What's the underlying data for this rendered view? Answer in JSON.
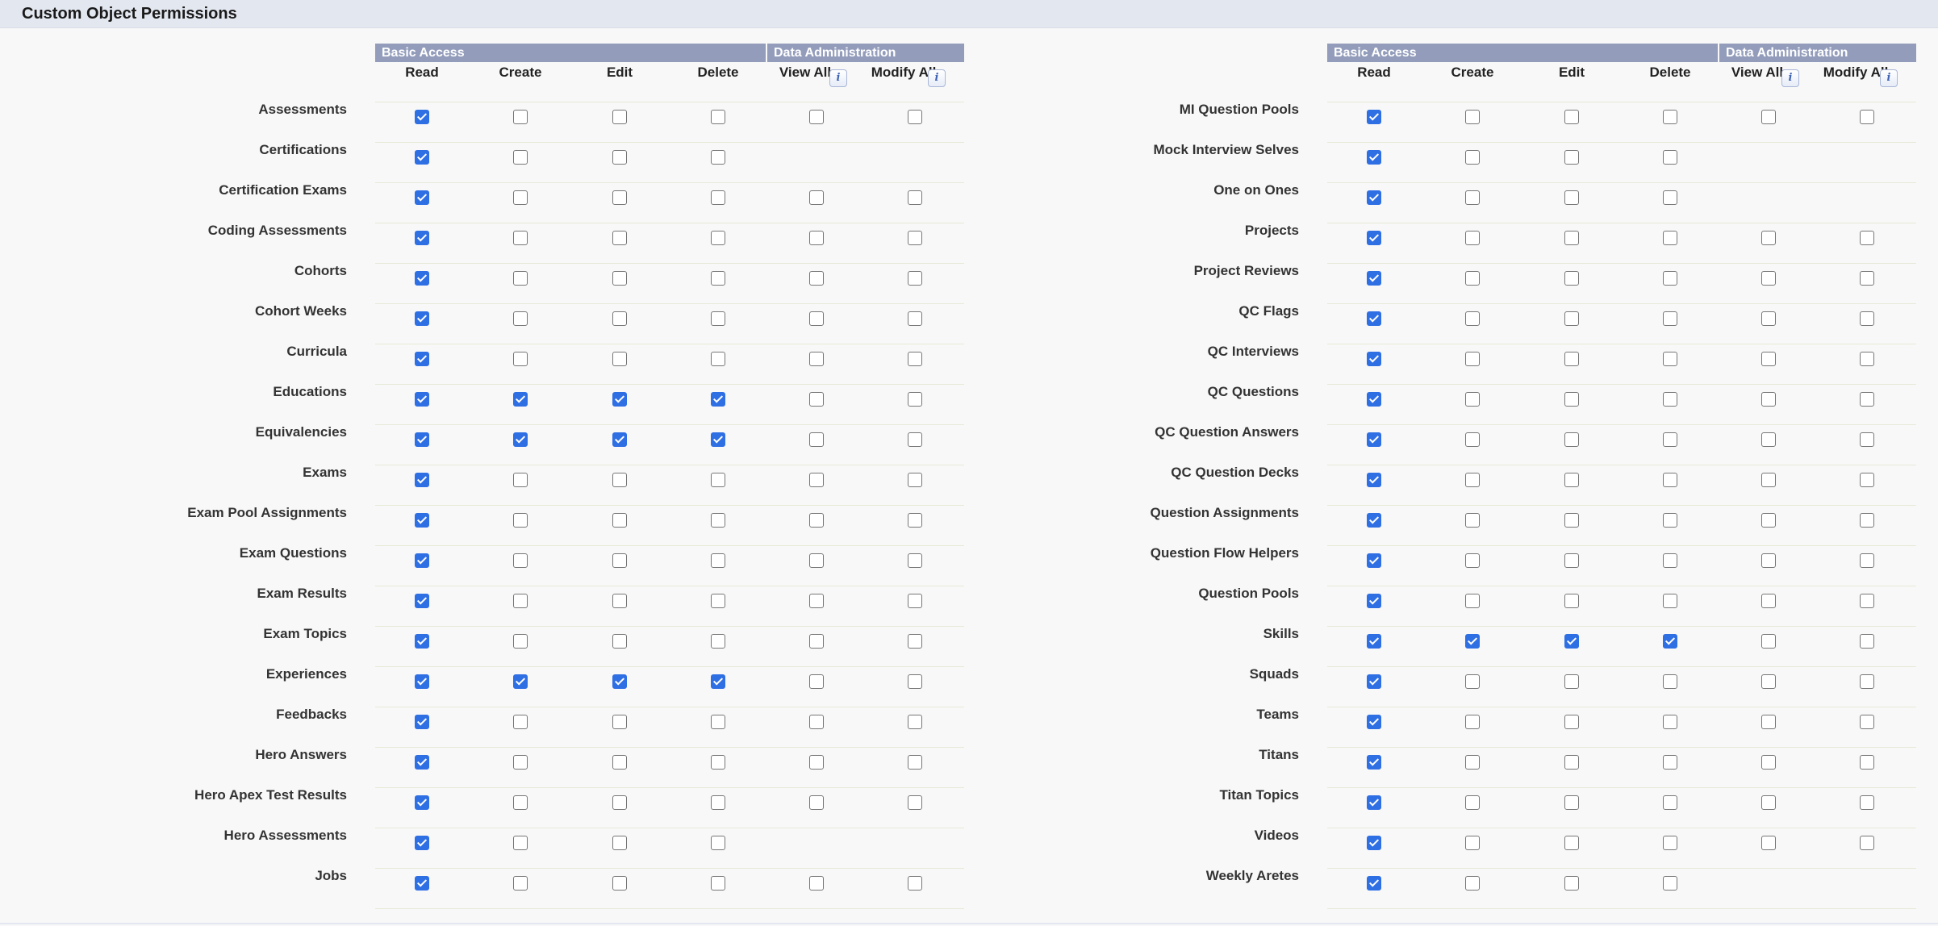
{
  "page": {
    "title": "Custom Object Permissions"
  },
  "groups": {
    "basic": "Basic Access",
    "admin": "Data Administration"
  },
  "columns": {
    "read": "Read",
    "create": "Create",
    "edit": "Edit",
    "delete": "Delete",
    "view_all": "View All",
    "modify_all": "Modify All"
  },
  "info_icon_glyph": "i",
  "colors": {
    "checked": "#2f6fe4",
    "group_header": "#939dbb",
    "title_bar": "#e3e7ef"
  },
  "tables": [
    {
      "rows": [
        {
          "label": "Assessments",
          "perms": [
            1,
            0,
            0,
            0,
            0,
            0
          ]
        },
        {
          "label": "Certifications",
          "perms": [
            1,
            0,
            0,
            0,
            null,
            null
          ]
        },
        {
          "label": "Certification Exams",
          "perms": [
            1,
            0,
            0,
            0,
            0,
            0
          ]
        },
        {
          "label": "Coding Assessments",
          "perms": [
            1,
            0,
            0,
            0,
            0,
            0
          ]
        },
        {
          "label": "Cohorts",
          "perms": [
            1,
            0,
            0,
            0,
            0,
            0
          ]
        },
        {
          "label": "Cohort Weeks",
          "perms": [
            1,
            0,
            0,
            0,
            0,
            0
          ]
        },
        {
          "label": "Curricula",
          "perms": [
            1,
            0,
            0,
            0,
            0,
            0
          ]
        },
        {
          "label": "Educations",
          "perms": [
            1,
            1,
            1,
            1,
            0,
            0
          ]
        },
        {
          "label": "Equivalencies",
          "perms": [
            1,
            1,
            1,
            1,
            0,
            0
          ]
        },
        {
          "label": "Exams",
          "perms": [
            1,
            0,
            0,
            0,
            0,
            0
          ]
        },
        {
          "label": "Exam Pool Assignments",
          "perms": [
            1,
            0,
            0,
            0,
            0,
            0
          ]
        },
        {
          "label": "Exam Questions",
          "perms": [
            1,
            0,
            0,
            0,
            0,
            0
          ]
        },
        {
          "label": "Exam Results",
          "perms": [
            1,
            0,
            0,
            0,
            0,
            0
          ]
        },
        {
          "label": "Exam Topics",
          "perms": [
            1,
            0,
            0,
            0,
            0,
            0
          ]
        },
        {
          "label": "Experiences",
          "perms": [
            1,
            1,
            1,
            1,
            0,
            0
          ]
        },
        {
          "label": "Feedbacks",
          "perms": [
            1,
            0,
            0,
            0,
            0,
            0
          ]
        },
        {
          "label": "Hero Answers",
          "perms": [
            1,
            0,
            0,
            0,
            0,
            0
          ]
        },
        {
          "label": "Hero Apex Test Results",
          "perms": [
            1,
            0,
            0,
            0,
            0,
            0
          ]
        },
        {
          "label": "Hero Assessments",
          "perms": [
            1,
            0,
            0,
            0,
            null,
            null
          ]
        },
        {
          "label": "Jobs",
          "perms": [
            1,
            0,
            0,
            0,
            0,
            0
          ]
        }
      ]
    },
    {
      "rows": [
        {
          "label": "MI Question Pools",
          "perms": [
            1,
            0,
            0,
            0,
            0,
            0
          ]
        },
        {
          "label": "Mock Interview Selves",
          "perms": [
            1,
            0,
            0,
            0,
            null,
            null
          ]
        },
        {
          "label": "One on Ones",
          "perms": [
            1,
            0,
            0,
            0,
            null,
            null
          ]
        },
        {
          "label": "Projects",
          "perms": [
            1,
            0,
            0,
            0,
            0,
            0
          ]
        },
        {
          "label": "Project Reviews",
          "perms": [
            1,
            0,
            0,
            0,
            0,
            0
          ]
        },
        {
          "label": "QC Flags",
          "perms": [
            1,
            0,
            0,
            0,
            0,
            0
          ]
        },
        {
          "label": "QC Interviews",
          "perms": [
            1,
            0,
            0,
            0,
            0,
            0
          ]
        },
        {
          "label": "QC Questions",
          "perms": [
            1,
            0,
            0,
            0,
            0,
            0
          ]
        },
        {
          "label": "QC Question Answers",
          "perms": [
            1,
            0,
            0,
            0,
            0,
            0
          ]
        },
        {
          "label": "QC Question Decks",
          "perms": [
            1,
            0,
            0,
            0,
            0,
            0
          ]
        },
        {
          "label": "Question Assignments",
          "perms": [
            1,
            0,
            0,
            0,
            0,
            0
          ]
        },
        {
          "label": "Question Flow Helpers",
          "perms": [
            1,
            0,
            0,
            0,
            0,
            0
          ]
        },
        {
          "label": "Question Pools",
          "perms": [
            1,
            0,
            0,
            0,
            0,
            0
          ]
        },
        {
          "label": "Skills",
          "perms": [
            1,
            1,
            1,
            1,
            0,
            0
          ]
        },
        {
          "label": "Squads",
          "perms": [
            1,
            0,
            0,
            0,
            0,
            0
          ]
        },
        {
          "label": "Teams",
          "perms": [
            1,
            0,
            0,
            0,
            0,
            0
          ]
        },
        {
          "label": "Titans",
          "perms": [
            1,
            0,
            0,
            0,
            0,
            0
          ]
        },
        {
          "label": "Titan Topics",
          "perms": [
            1,
            0,
            0,
            0,
            0,
            0
          ]
        },
        {
          "label": "Videos",
          "perms": [
            1,
            0,
            0,
            0,
            0,
            0
          ]
        },
        {
          "label": "Weekly Aretes",
          "perms": [
            1,
            0,
            0,
            0,
            null,
            null
          ]
        }
      ]
    }
  ]
}
